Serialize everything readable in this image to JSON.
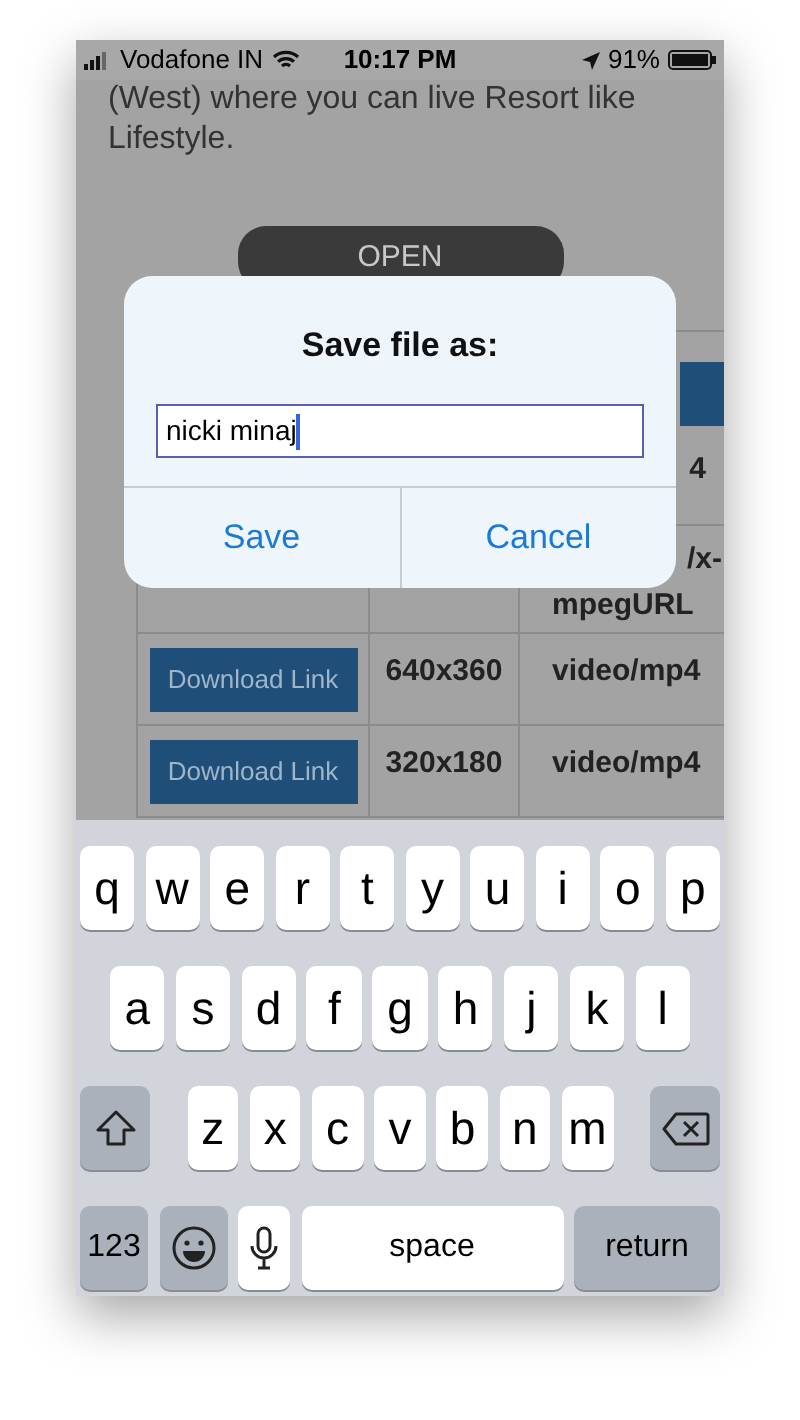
{
  "status_bar": {
    "carrier": "Vodafone IN",
    "time": "10:17 PM",
    "battery": "91%"
  },
  "page": {
    "text_lines": [
      "(West) where you can live Resort like",
      "Lifestyle."
    ],
    "open_button": "OPEN",
    "table_rows": [
      {
        "button": null,
        "resolution": null,
        "type_parts": [
          "4"
        ]
      },
      {
        "button": null,
        "resolution": null,
        "type_parts": [
          "/x-",
          "mpegURL"
        ]
      },
      {
        "button": "Download Link",
        "resolution": "640x360",
        "type_parts": [
          "video/mp4"
        ]
      },
      {
        "button": "Download Link",
        "resolution": "320x180",
        "type_parts": [
          "video/mp4"
        ]
      }
    ]
  },
  "dialog": {
    "title": "Save file as:",
    "input_value": "nicki minaj",
    "buttons": [
      "Save",
      "Cancel"
    ]
  },
  "keyboard": {
    "key_rows": [
      {
        "keys": [
          {
            "kind": "letter",
            "label": "q"
          },
          {
            "kind": "letter",
            "label": "w"
          },
          {
            "kind": "letter",
            "label": "e"
          },
          {
            "kind": "letter",
            "label": "r"
          },
          {
            "kind": "letter",
            "label": "t"
          },
          {
            "kind": "letter",
            "label": "y"
          },
          {
            "kind": "letter",
            "label": "u"
          },
          {
            "kind": "letter",
            "label": "i"
          },
          {
            "kind": "letter",
            "label": "o"
          },
          {
            "kind": "letter",
            "label": "p"
          }
        ]
      },
      {
        "keys": [
          {
            "kind": "letter",
            "label": "a"
          },
          {
            "kind": "letter",
            "label": "s"
          },
          {
            "kind": "letter",
            "label": "d"
          },
          {
            "kind": "letter",
            "label": "f"
          },
          {
            "kind": "letter",
            "label": "g"
          },
          {
            "kind": "letter",
            "label": "h"
          },
          {
            "kind": "letter",
            "label": "j"
          },
          {
            "kind": "letter",
            "label": "k"
          },
          {
            "kind": "letter",
            "label": "l"
          }
        ]
      },
      {
        "keys": [
          {
            "kind": "shift"
          },
          {
            "kind": "letter",
            "label": "z"
          },
          {
            "kind": "letter",
            "label": "x"
          },
          {
            "kind": "letter",
            "label": "c"
          },
          {
            "kind": "letter",
            "label": "v"
          },
          {
            "kind": "letter",
            "label": "b"
          },
          {
            "kind": "letter",
            "label": "n"
          },
          {
            "kind": "letter",
            "label": "m"
          },
          {
            "kind": "delete"
          }
        ]
      },
      {
        "keys": [
          {
            "kind": "numbers",
            "label": "123"
          },
          {
            "kind": "emoji"
          },
          {
            "kind": "mic"
          },
          {
            "kind": "space",
            "label": "space"
          },
          {
            "kind": "return",
            "label": "return"
          }
        ]
      }
    ]
  }
}
